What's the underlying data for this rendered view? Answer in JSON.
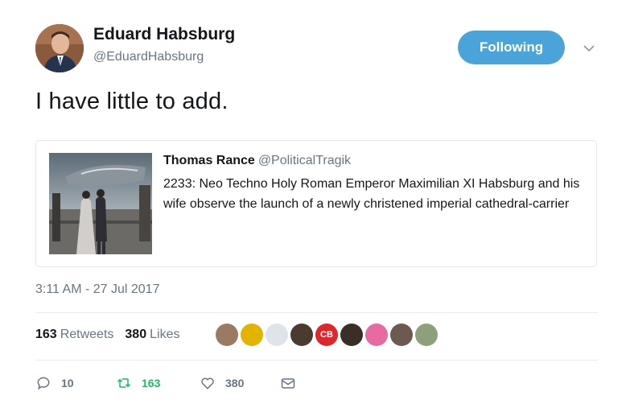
{
  "author": {
    "name": "Eduard Habsburg",
    "handle": "@EduardHabsburg",
    "follow_label": "Following"
  },
  "tweet": {
    "text": "I have little to add.",
    "timestamp": "3:11 AM - 27 Jul 2017"
  },
  "quoted": {
    "name": "Thomas Rance",
    "handle": "@PoliticalTragik",
    "text": "2233: Neo Techno Holy Roman Emperor Maximilian XI Habsburg and his wife observe the launch of a newly christened imperial cathedral-carrier"
  },
  "stats": {
    "retweets_count": "163",
    "retweets_label": "Retweets",
    "likes_count": "380",
    "likes_label": "Likes"
  },
  "actions": {
    "replies": "10",
    "retweets": "163",
    "likes": "380"
  },
  "likers": [
    {
      "name": "liker-avatar-1",
      "color": "#9b7a63"
    },
    {
      "name": "liker-avatar-2",
      "color": "#e2b400"
    },
    {
      "name": "liker-avatar-3",
      "color": "#dfe4ea"
    },
    {
      "name": "liker-avatar-4",
      "color": "#4b3a2e"
    },
    {
      "name": "liker-avatar-5",
      "color": "#e0262b",
      "label": "CB"
    },
    {
      "name": "liker-avatar-6",
      "color": "#3a2f26"
    },
    {
      "name": "liker-avatar-7",
      "color": "#e76aa3"
    },
    {
      "name": "liker-avatar-8",
      "color": "#6c5a4e"
    },
    {
      "name": "liker-avatar-9",
      "color": "#8ca07a"
    }
  ],
  "colors": {
    "accent": "#4aa3d9",
    "retweet_green": "#17bf63",
    "muted": "#657786"
  }
}
